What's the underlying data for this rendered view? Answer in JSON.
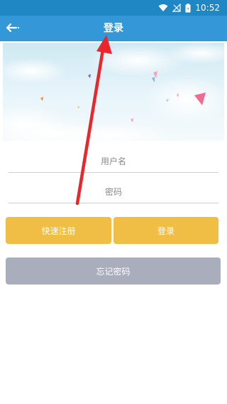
{
  "status_bar": {
    "time": "10:52",
    "icons": [
      "wifi-icon",
      "no-signal-icon",
      "battery-icon"
    ]
  },
  "app_bar": {
    "title": "登录",
    "back_icon": "back-arrow-icon"
  },
  "banner": {
    "type": "decorative-sky-image"
  },
  "form": {
    "username_placeholder": "用户名",
    "username_value": "",
    "password_placeholder": "密码",
    "password_value": ""
  },
  "buttons": {
    "register_label": "快速注册",
    "login_label": "登录",
    "forgot_label": "忘记密码"
  },
  "colors": {
    "status_bar": "#1f87c3",
    "app_bar": "#3497d8",
    "primary_button": "#f0bd45",
    "secondary_button": "#a9adbc",
    "annotation_arrow": "#e8262b"
  }
}
